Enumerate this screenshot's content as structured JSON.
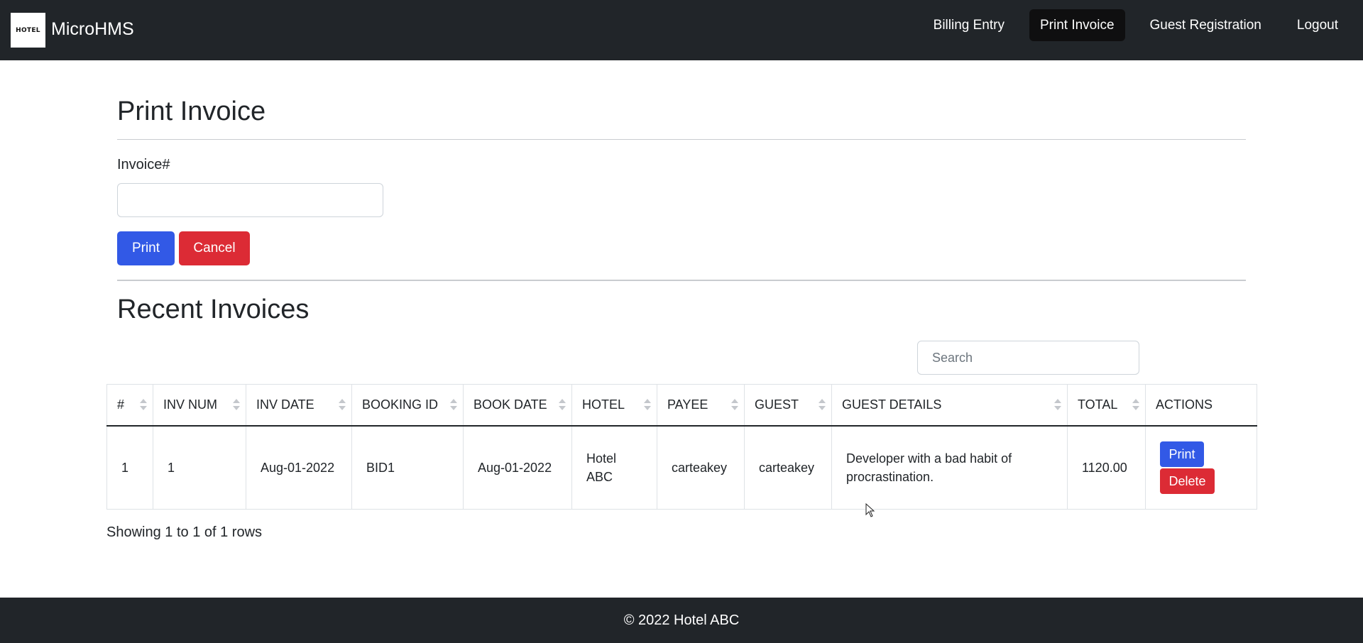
{
  "brand": {
    "logo_text": "HOTEL",
    "name": "MicroHMS"
  },
  "nav": {
    "items": [
      {
        "label": "Billing Entry"
      },
      {
        "label": "Print Invoice",
        "active": true
      },
      {
        "label": "Guest Registration"
      },
      {
        "label": "Logout"
      }
    ]
  },
  "print_invoice": {
    "title": "Print Invoice",
    "invoice_label": "Invoice#",
    "invoice_value": "",
    "print_label": "Print",
    "cancel_label": "Cancel"
  },
  "recent": {
    "title": "Recent Invoices",
    "search_placeholder": "Search",
    "columns": [
      "#",
      "INV NUM",
      "INV DATE",
      "BOOKING ID",
      "BOOK DATE",
      "HOTEL",
      "PAYEE",
      "GUEST",
      "GUEST DETAILS",
      "TOTAL",
      "ACTIONS"
    ],
    "rows": [
      {
        "index": "1",
        "inv_num": "1",
        "inv_date": "Aug-01-2022",
        "booking_id": "BID1",
        "book_date": "Aug-01-2022",
        "hotel": "Hotel ABC",
        "payee": "carteakey",
        "guest": "carteakey",
        "guest_details": "Developer with a bad habit of procrastination.",
        "total": "1120.00",
        "print_label": "Print",
        "delete_label": "Delete"
      }
    ],
    "pagination_text": "Showing 1 to 1 of 1 rows"
  },
  "footer": {
    "text": "© 2022 Hotel ABC"
  },
  "colors": {
    "navbar": "#212529",
    "primary": "#3259e6",
    "danger": "#dc2b35"
  }
}
